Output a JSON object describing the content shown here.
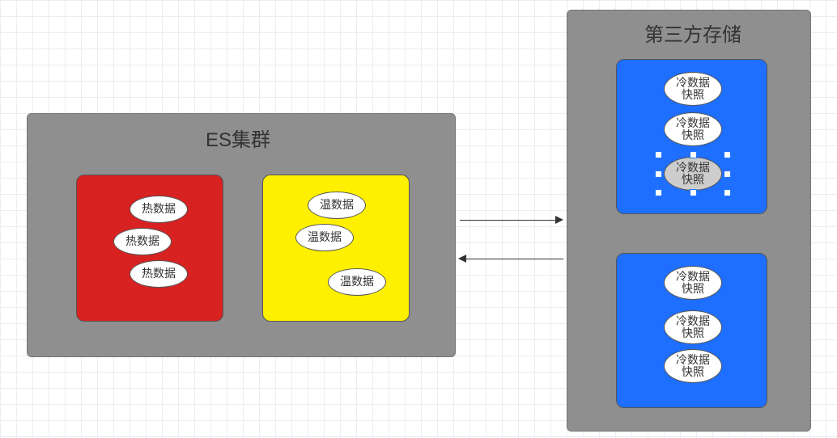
{
  "es_cluster": {
    "title": "ES集群",
    "hot_block": {
      "items": [
        "热数据",
        "热数据",
        "热数据"
      ]
    },
    "warm_block": {
      "items": [
        "温数据",
        "温数据",
        "温数据"
      ]
    }
  },
  "third_party": {
    "title": "第三方存储",
    "cold_block_1": {
      "items": [
        "冷数据\n快照",
        "冷数据\n快照",
        "冷数据\n快照"
      ]
    },
    "cold_block_2": {
      "items": [
        "冷数据\n快照",
        "冷数据\n快照",
        "冷数据\n快照"
      ]
    }
  },
  "colors": {
    "panel": "#8f8f8f",
    "hot": "#d82222",
    "warm": "#fff000",
    "cold": "#1e6fff"
  }
}
